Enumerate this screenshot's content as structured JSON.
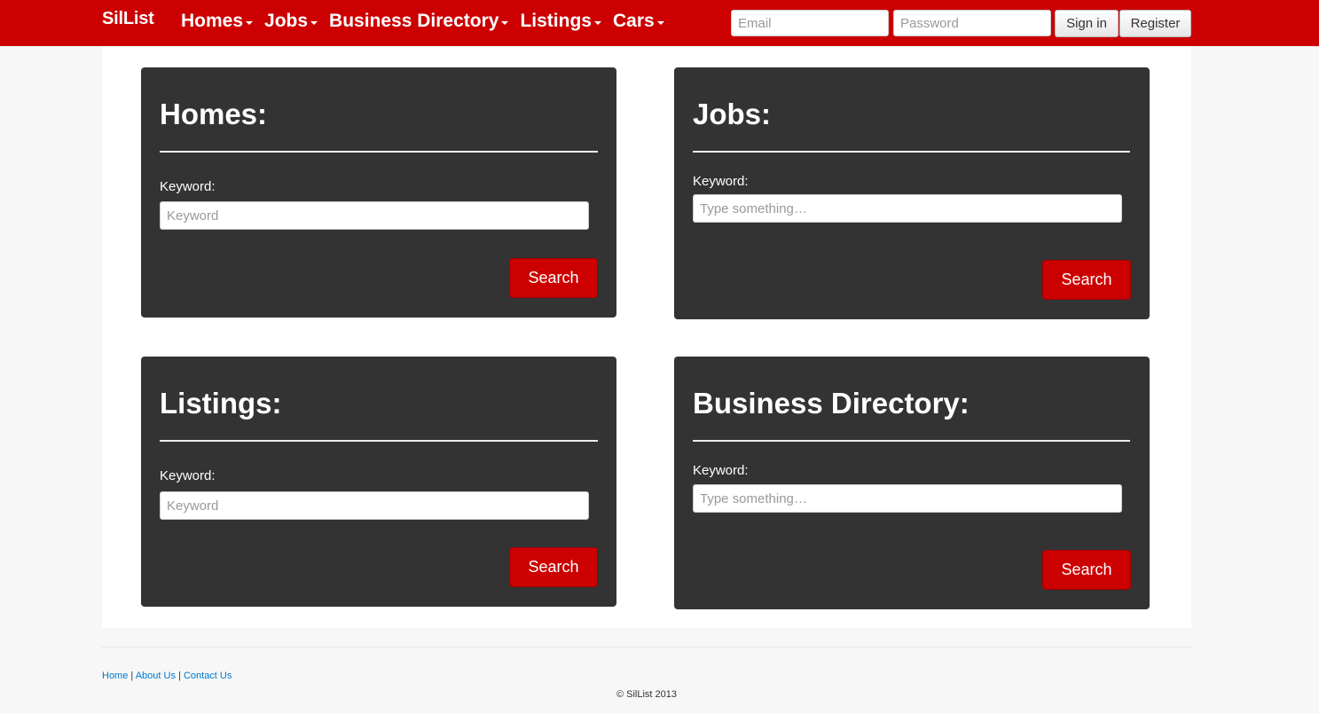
{
  "navbar": {
    "brand": "SilList",
    "menu": [
      {
        "label": "Homes"
      },
      {
        "label": "Jobs"
      },
      {
        "label": "Business Directory"
      },
      {
        "label": "Listings"
      },
      {
        "label": "Cars"
      }
    ],
    "email_placeholder": "Email",
    "password_placeholder": "Password",
    "signin_label": "Sign in",
    "register_label": "Register"
  },
  "panels": {
    "homes": {
      "title": "Homes:",
      "keyword_label": "Keyword:",
      "placeholder": "Keyword",
      "button": "Search"
    },
    "jobs": {
      "title": "Jobs:",
      "keyword_label": "Keyword:",
      "placeholder": "Type something…",
      "button": "Search"
    },
    "listings": {
      "title": "Listings:",
      "keyword_label": "Keyword:",
      "placeholder": "Keyword",
      "button": "Search"
    },
    "business": {
      "title": "Business Directory:",
      "keyword_label": "Keyword:",
      "placeholder": "Type something…",
      "button": "Search"
    }
  },
  "footer": {
    "links": [
      "Home",
      "About Us",
      "Contact Us"
    ],
    "separator": "|",
    "copyright": "© SilList 2013"
  },
  "colors": {
    "brand_red": "#cc0000",
    "panel_bg": "#333333",
    "page_bg": "#f7f7f7",
    "link_blue": "#0077cc"
  }
}
